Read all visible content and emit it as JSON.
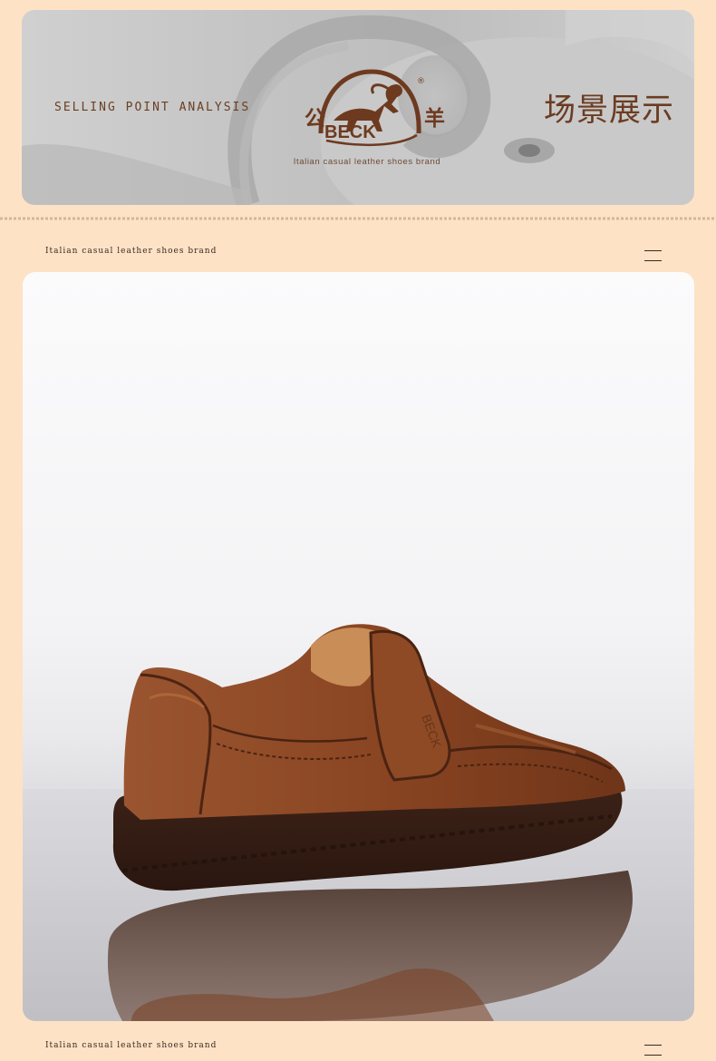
{
  "banner": {
    "selling_point": "SELLING POINT ANALYSIS",
    "scene_title": "场景展示"
  },
  "logo": {
    "char_left": "公",
    "char_right": "羊",
    "brand": "BECK",
    "registered": "®",
    "tagline": "Italian casual leather shoes brand"
  },
  "captions": {
    "top": "Italian casual leather shoes brand",
    "bottom": "Italian casual leather shoes brand"
  },
  "photo": {
    "subject": "shoe-photo"
  },
  "colors": {
    "page_bg": "#fde2c6",
    "brand_brown": "#6e3a1f",
    "leather": "#8a4a24"
  }
}
